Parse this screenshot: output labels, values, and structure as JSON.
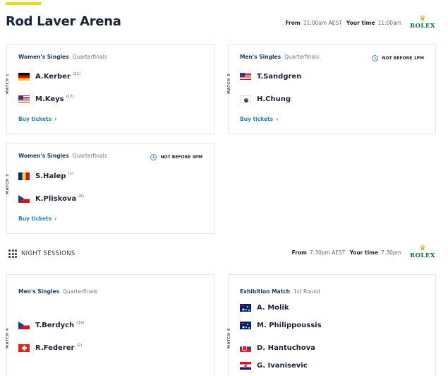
{
  "court": {
    "title": "Rod Laver Arena"
  },
  "day_session": {
    "from_label": "From",
    "from_value": "11:00am AEST",
    "your_time_label": "Your time",
    "your_time_value": "11:00am",
    "sponsor": "ROLEX"
  },
  "night_session": {
    "title": "NIGHT SESSIONS",
    "from_label": "From",
    "from_value": "7:30pm AEST",
    "your_time_label": "Your time",
    "your_time_value": "7:30pm",
    "sponsor": "ROLEX"
  },
  "matches": [
    {
      "label": "MATCH 1",
      "event": "Women's Singles",
      "round": "Quarterfinals",
      "not_before": "",
      "players": [
        {
          "name": "A.Kerber",
          "seed": "(21)",
          "flag": "germany"
        },
        {
          "name": "M.Keys",
          "seed": "(17)",
          "flag": "usa"
        }
      ],
      "buy": "Buy tickets"
    },
    {
      "label": "MATCH 2",
      "event": "Men's Singles",
      "round": "Quarterfinals",
      "not_before": "NOT BEFORE 1PM",
      "players": [
        {
          "name": "T.Sandgren",
          "seed": "",
          "flag": "usa"
        },
        {
          "name": "H.Chung",
          "seed": "",
          "flag": "south-korea"
        }
      ],
      "buy": "Buy tickets"
    },
    {
      "label": "MATCH 3",
      "event": "Women's Singles",
      "round": "Quarterfinals",
      "not_before": "NOT BEFORE 3PM",
      "players": [
        {
          "name": "S.Halep",
          "seed": "(1)",
          "flag": "romania"
        },
        {
          "name": "K.Pliskova",
          "seed": "(6)",
          "flag": "czech-republic"
        }
      ],
      "buy": "Buy tickets"
    },
    {
      "label": "MATCH 4",
      "event": "Men's Singles",
      "round": "Quarterfinals",
      "not_before": "",
      "players": [
        {
          "name": "T.Berdych",
          "seed": "(19)",
          "flag": "czech-republic"
        },
        {
          "name": "R.Federer",
          "seed": "(2)",
          "flag": "switzerland"
        }
      ],
      "buy": ""
    },
    {
      "label": "MATCH 5",
      "event": "Exhibition Match",
      "round": "1st Round",
      "not_before": "",
      "players": [
        {
          "name": "A. Molik",
          "seed": "",
          "flag": "australia"
        },
        {
          "name": "M. Philippoussis",
          "seed": "",
          "flag": "australia"
        },
        {
          "name": "D. Hantuchova",
          "seed": "",
          "flag": "slovakia"
        },
        {
          "name": "G. Ivanisevic",
          "seed": "",
          "flag": "croatia"
        }
      ],
      "buy": ""
    }
  ]
}
